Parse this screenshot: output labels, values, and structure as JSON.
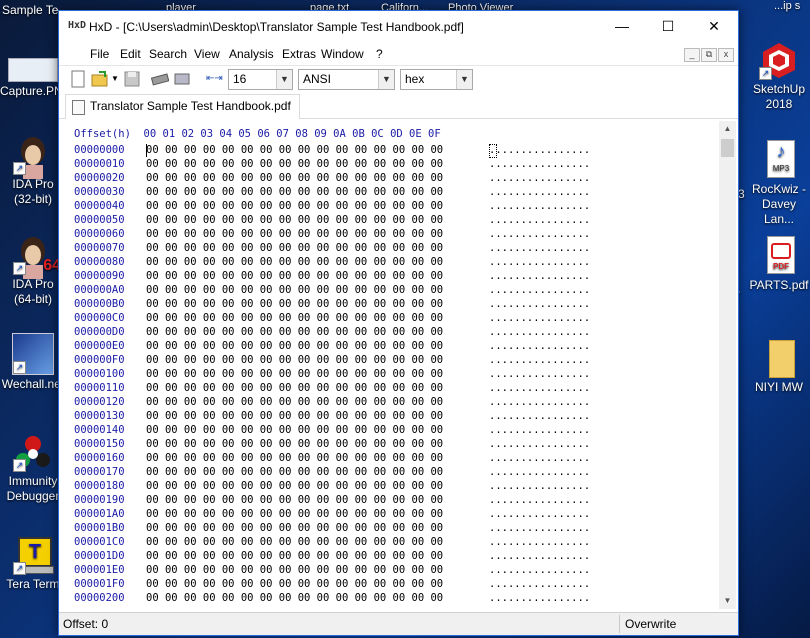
{
  "desktop": {
    "top_labels": [
      "Sample Te...",
      "player",
      "page.txt",
      "Californ...",
      "Photo Viewer",
      "...ip s"
    ],
    "left_icons": [
      {
        "label": "Capture.PNG",
        "icon": "image-icon"
      },
      {
        "label": "IDA Pro (32-bit)",
        "icon": "ida-pro-icon"
      },
      {
        "label": "IDA Pro (64-bit)",
        "icon": "ida-pro-64-icon",
        "badge": "64"
      },
      {
        "label": "Wechall.net",
        "icon": "wechall-icon"
      },
      {
        "label": "Immunity Debugger",
        "icon": "immunity-debugger-icon"
      },
      {
        "label": "Tera Term",
        "icon": "tera-term-icon",
        "glyph": "T"
      }
    ],
    "right_icons": [
      {
        "label": "SketchUp 2018",
        "icon": "sketchup-icon"
      },
      {
        "label": "RocKwiz - Davey Lan...",
        "icon": "mp3-file-icon",
        "glyph": "MP3"
      },
      {
        "label": "PARTS.pdf",
        "icon": "pdf-file-icon",
        "glyph": "PDF"
      },
      {
        "label": "NIYI MW",
        "icon": "folder-icon"
      }
    ],
    "edge_fragments": [
      "3",
      "r"
    ]
  },
  "window": {
    "app_icon": "HxD",
    "title": "HxD - [C:\\Users\\admin\\Desktop\\Translator Sample Test Handbook.pdf]",
    "controls": {
      "minimize": "—",
      "maximize": "☐",
      "close": "✕"
    },
    "menu": [
      "File",
      "Edit",
      "Search",
      "View",
      "Analysis",
      "Extras",
      "Window",
      "?"
    ],
    "mdi_controls": [
      "_",
      "⧉",
      "x"
    ],
    "toolbar": {
      "bytes_per_row": "16",
      "charset": "ANSI",
      "offset_base": "hex"
    },
    "tab": "Translator Sample Test Handbook.pdf",
    "hex_header": "Offset(h)  00 01 02 03 04 05 06 07 08 09 0A 0B 0C 0D 0E 0F",
    "rows": [
      {
        "offset": "00000000"
      },
      {
        "offset": "00000010"
      },
      {
        "offset": "00000020"
      },
      {
        "offset": "00000030"
      },
      {
        "offset": "00000040"
      },
      {
        "offset": "00000050"
      },
      {
        "offset": "00000060"
      },
      {
        "offset": "00000070"
      },
      {
        "offset": "00000080"
      },
      {
        "offset": "00000090"
      },
      {
        "offset": "000000A0"
      },
      {
        "offset": "000000B0"
      },
      {
        "offset": "000000C0"
      },
      {
        "offset": "000000D0"
      },
      {
        "offset": "000000E0"
      },
      {
        "offset": "000000F0"
      },
      {
        "offset": "00000100"
      },
      {
        "offset": "00000110"
      },
      {
        "offset": "00000120"
      },
      {
        "offset": "00000130"
      },
      {
        "offset": "00000140"
      },
      {
        "offset": "00000150"
      },
      {
        "offset": "00000160"
      },
      {
        "offset": "00000170"
      },
      {
        "offset": "00000180"
      },
      {
        "offset": "00000190"
      },
      {
        "offset": "000001A0"
      },
      {
        "offset": "000001B0"
      },
      {
        "offset": "000001C0"
      },
      {
        "offset": "000001D0"
      },
      {
        "offset": "000001E0"
      },
      {
        "offset": "000001F0"
      },
      {
        "offset": "00000200"
      }
    ],
    "row_hex": "00 00 00 00 00 00 00 00 00 00 00 00 00 00 00 00",
    "row_ascii": "................",
    "status": {
      "offset": "Offset: 0",
      "mode": "Overwrite"
    }
  }
}
